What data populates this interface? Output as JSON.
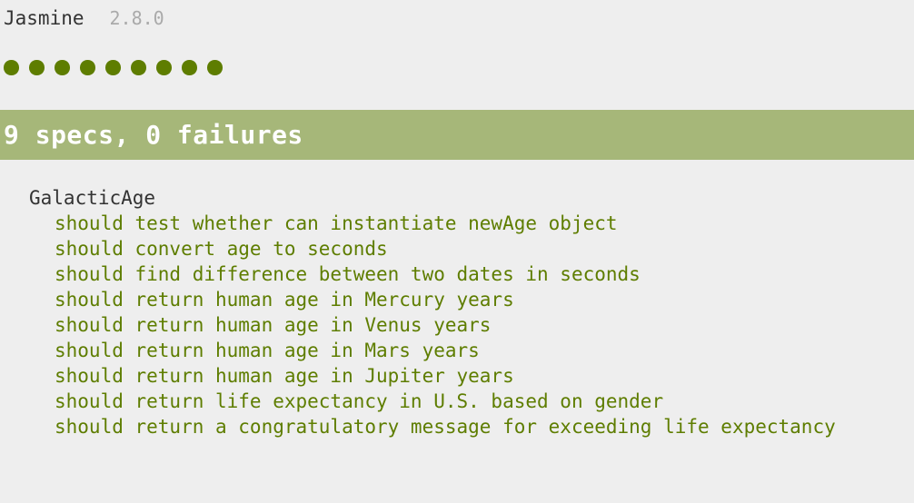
{
  "banner": {
    "title": "Jasmine",
    "version": "2.8.0"
  },
  "colors": {
    "pass": "#5e7d00",
    "status_bar": "#a6b779",
    "status_text": "#ffffff",
    "suite_text": "#333333",
    "version_text": "#aaaaaa"
  },
  "symbol_summary": {
    "count": 9,
    "states": [
      "passed",
      "passed",
      "passed",
      "passed",
      "passed",
      "passed",
      "passed",
      "passed",
      "passed"
    ]
  },
  "status": {
    "text": "9 specs, 0 failures"
  },
  "suite": {
    "name": "GalacticAge",
    "specs": [
      "should test whether can instantiate newAge object",
      "should convert age to seconds",
      "should find difference between two dates in seconds",
      "should return human age in Mercury years",
      "should return human age in Venus years",
      "should return human age in Mars years",
      "should return human age in Jupiter years",
      "should return life expectancy in U.S. based on gender",
      "should return a congratulatory message for exceeding life expectancy"
    ]
  }
}
